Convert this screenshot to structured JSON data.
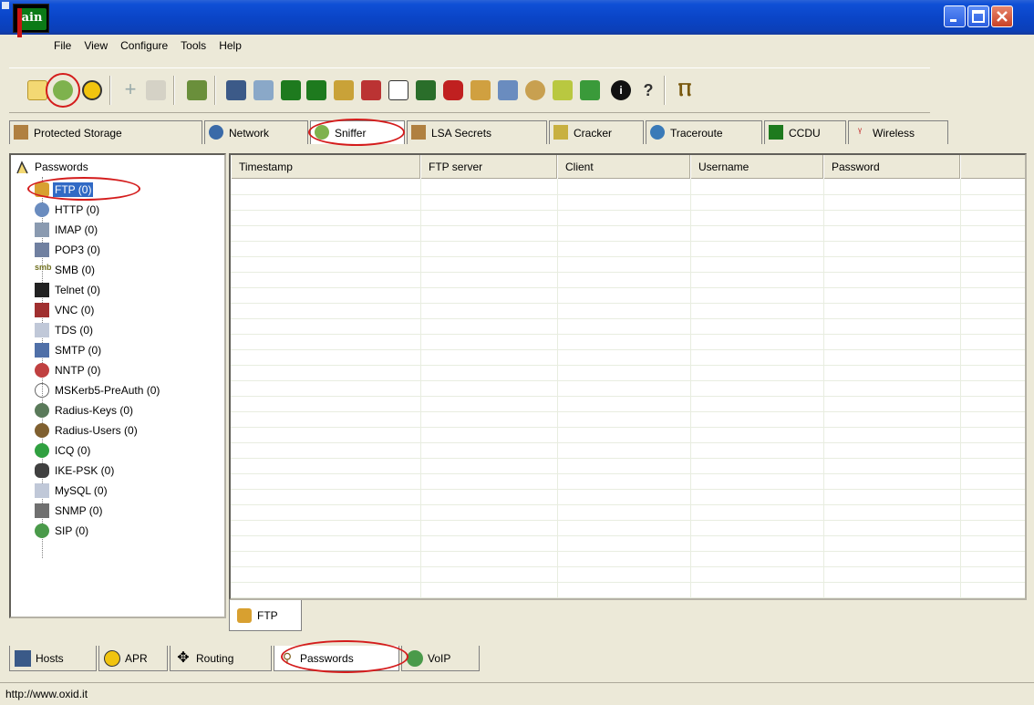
{
  "app": {
    "logo_text": "ain"
  },
  "menu": [
    "File",
    "View",
    "Configure",
    "Tools",
    "Help"
  ],
  "toolbar": {
    "icons": [
      "open-folder-icon",
      "sniffer-icon",
      "apr-icon",
      "add-host-icon",
      "delete-icon",
      "scan-icon",
      "base64-icon",
      "network-icon",
      "rt-tables-icon",
      "rt-tables-2-icon",
      "key-icon",
      "vnc-icon",
      "password-icon",
      "lcd-icon",
      "cisco-icon",
      "hash-icon",
      "wireless-icon",
      "disk-icon",
      "edit-icon",
      "wifi-icon",
      "info-icon",
      "help-icon",
      "exit-icon"
    ]
  },
  "top_tabs": [
    {
      "label": "Protected Storage",
      "icon": "storage-icon"
    },
    {
      "label": "Network",
      "icon": "network-globe-icon"
    },
    {
      "label": "Sniffer",
      "icon": "sniffer-icon",
      "active": true
    },
    {
      "label": "LSA Secrets",
      "icon": "lsa-icon"
    },
    {
      "label": "Cracker",
      "icon": "cracker-icon"
    },
    {
      "label": "Traceroute",
      "icon": "traceroute-icon"
    },
    {
      "label": "CCDU",
      "icon": "ccdu-icon"
    },
    {
      "label": "Wireless",
      "icon": "wireless-antenna-icon"
    }
  ],
  "tree": {
    "root": "Passwords",
    "items": [
      {
        "label": "FTP (0)",
        "icon": "ftp-icon",
        "selected": true
      },
      {
        "label": "HTTP (0)",
        "icon": "http-icon"
      },
      {
        "label": "IMAP (0)",
        "icon": "imap-icon"
      },
      {
        "label": "POP3 (0)",
        "icon": "pop3-icon"
      },
      {
        "label": "SMB (0)",
        "icon": "smb-icon"
      },
      {
        "label": "Telnet (0)",
        "icon": "telnet-icon"
      },
      {
        "label": "VNC (0)",
        "icon": "vnc-icon"
      },
      {
        "label": "TDS (0)",
        "icon": "tds-icon"
      },
      {
        "label": "SMTP (0)",
        "icon": "smtp-icon"
      },
      {
        "label": "NNTP (0)",
        "icon": "nntp-icon"
      },
      {
        "label": "MSKerb5-PreAuth (0)",
        "icon": "kerberos-icon"
      },
      {
        "label": "Radius-Keys (0)",
        "icon": "radius-keys-icon"
      },
      {
        "label": "Radius-Users (0)",
        "icon": "radius-users-icon"
      },
      {
        "label": "ICQ (0)",
        "icon": "icq-icon"
      },
      {
        "label": "IKE-PSK (0)",
        "icon": "ike-icon"
      },
      {
        "label": "MySQL (0)",
        "icon": "mysql-icon"
      },
      {
        "label": "SNMP (0)",
        "icon": "snmp-icon"
      },
      {
        "label": "SIP (0)",
        "icon": "sip-icon"
      }
    ]
  },
  "table": {
    "columns": [
      "Timestamp",
      "FTP server",
      "Client",
      "Username",
      "Password"
    ],
    "rows": []
  },
  "list_tab": "FTP",
  "bottom_tabs": [
    {
      "label": "Hosts",
      "icon": "hosts-icon"
    },
    {
      "label": "APR",
      "icon": "apr-icon"
    },
    {
      "label": "Routing",
      "icon": "routing-icon"
    },
    {
      "label": "Passwords",
      "icon": "passwords-icon",
      "active": true
    },
    {
      "label": "VoIP",
      "icon": "voip-icon"
    }
  ],
  "status": "http://www.oxid.it",
  "colors": {
    "titlebar": "#0a45c8",
    "selection": "#316ac5",
    "annotation": "#d41c1c"
  }
}
